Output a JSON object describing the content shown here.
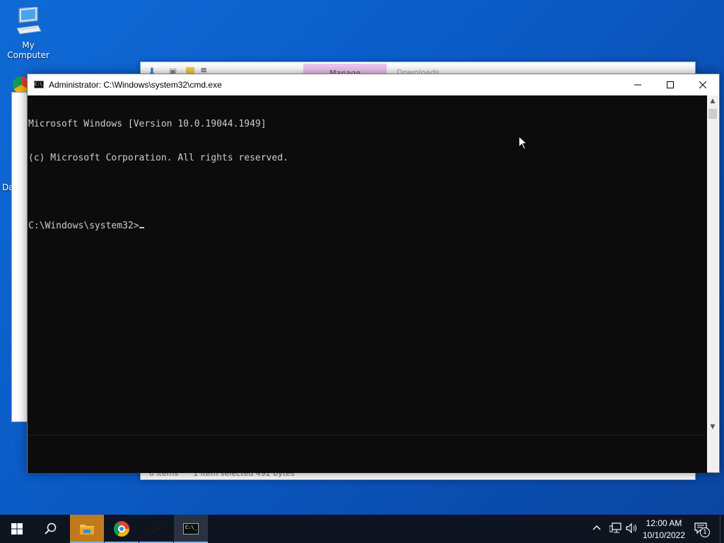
{
  "desktop": {
    "icons": [
      {
        "label": "My Computer",
        "icon": "computer-icon"
      },
      {
        "label": "Da",
        "icon": "partial-icon"
      }
    ]
  },
  "explorer": {
    "manage_tab": "Manage",
    "title_hint": "Downloads",
    "status_items": "0 items",
    "status_selected": "1 item selected  492 bytes"
  },
  "cmd": {
    "title": "Administrator: C:\\Windows\\system32\\cmd.exe",
    "lines": [
      "Microsoft Windows [Version 10.0.19044.1949]",
      "(c) Microsoft Corporation. All rights reserved.",
      "",
      "C:\\Windows\\system32>"
    ],
    "minimize_symbol": "—",
    "maximize_symbol": "☐",
    "close_symbol": "✕"
  },
  "taskbar": {
    "time": "12:00 AM",
    "date": "10/10/2022",
    "notification_count": "1",
    "apps": [
      "start-icon",
      "search-icon",
      "file-explorer-icon",
      "chrome-icon",
      "tool-icon",
      "cmd-icon"
    ]
  }
}
